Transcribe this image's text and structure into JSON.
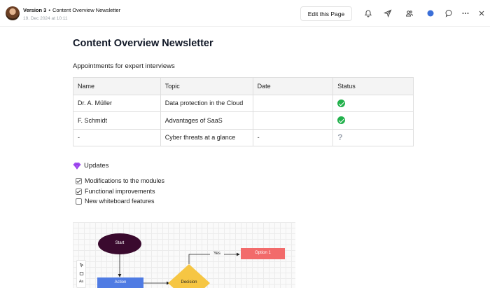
{
  "header": {
    "version": "Version 3",
    "separator": "•",
    "doc_title": "Content Overview Newsletter",
    "timestamp": "19. Dec 2024 at 10:11",
    "edit_label": "Edit this Page",
    "icons": [
      "bell-icon",
      "send-icon",
      "users-icon",
      "status-dot-icon",
      "comment-icon",
      "more-icon",
      "close-icon"
    ],
    "status_dot_color": "#3b6fd8"
  },
  "page": {
    "title": "Content Overview Newsletter",
    "subtitle": "Appointments for expert interviews"
  },
  "table": {
    "headers": [
      "Name",
      "Topic",
      "Date",
      "Status"
    ],
    "rows": [
      {
        "name": "Dr. A. Müller",
        "topic": "Data protection in the Cloud",
        "date": "",
        "status": "done"
      },
      {
        "name": "F. Schmidt",
        "topic": "Advantages of SaaS",
        "date": "",
        "status": "done"
      },
      {
        "name": "-",
        "topic": "Cyber threats at a glance",
        "date": "-",
        "status": "?"
      }
    ]
  },
  "updates": {
    "title": "Updates",
    "icon": "gem-icon",
    "items": [
      {
        "label": "Modifications to the modules",
        "checked": true
      },
      {
        "label": "Functional improvements",
        "checked": true
      },
      {
        "label": "New whiteboard features",
        "checked": false
      }
    ]
  },
  "whiteboard": {
    "shapes": {
      "start": "Start",
      "action": "Action",
      "decision": "Decision",
      "option1": "Option 1",
      "yes": "Yes"
    },
    "tools": [
      "cursor-icon",
      "rectangle-icon",
      "text-tool-icon"
    ],
    "text_tool_label": "Aa",
    "colors": {
      "start": "#3a0a2e",
      "action": "#4f7be3",
      "decision": "#f6c643",
      "option1": "#f26b6b"
    }
  }
}
